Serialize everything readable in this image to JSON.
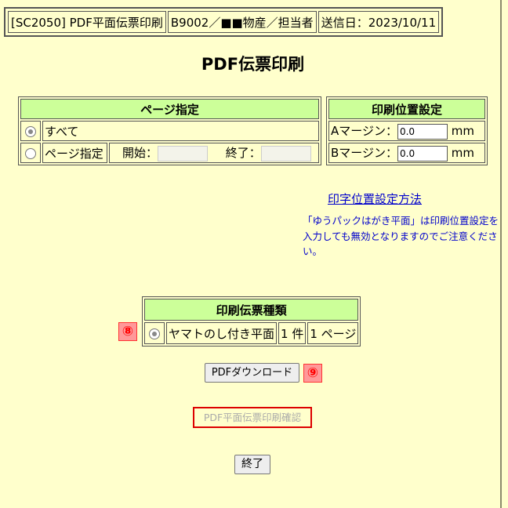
{
  "header": {
    "screen_id": "[SC2050] PDF平面伝票印刷",
    "user": "B9002／■■物産／担当者",
    "send_date": "送信日：2023/10/11"
  },
  "page_title": "PDF伝票印刷",
  "page_spec": {
    "header": "ページ指定",
    "all_label": "すべて",
    "all_selected": true,
    "range_label": "ページ指定",
    "start_label": "開始：",
    "end_label": "終了："
  },
  "print_position": {
    "header": "印刷位置設定",
    "margin_a_label": "Aマージン：",
    "margin_a_value": "0.0",
    "margin_b_label": "Bマージン：",
    "margin_b_value": "0.0",
    "unit": "mm"
  },
  "help_link": "印字位置設定方法",
  "note_lines": [
    "「ゆうパックはがき平面」は印刷位置設定を",
    "入力しても無効となりますのでご注意ください。"
  ],
  "slip_type": {
    "header": "印刷伝票種類",
    "name": "ヤマトのし付き平面",
    "count": "1 件",
    "pages": "1 ページ",
    "selected": true
  },
  "badges": {
    "b8": "⑧",
    "b9": "⑨"
  },
  "buttons": {
    "download": "PDFダウンロード",
    "confirm": "PDF平面伝票印刷確認",
    "end": "終了"
  },
  "colors": {
    "background": "#ffffcc",
    "header_green": "#ccff99",
    "link_blue": "#0000cc",
    "highlight_red": "#dd0000"
  }
}
